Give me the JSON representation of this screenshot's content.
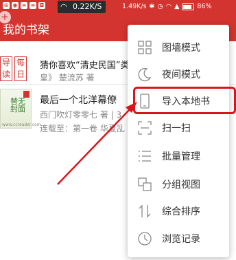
{
  "status_bar": {
    "speed": "0.22K/S",
    "net_rate": "1.49K/s",
    "battery": "86%"
  },
  "app_bar": {
    "title": "我的书架",
    "add_glyph": "+"
  },
  "books": [
    {
      "badge_left": "导读",
      "badge_right": "每日",
      "title": "猜你喜欢“清史民国”类",
      "subtitle": "皇》 楚流苏 著"
    },
    {
      "cover_text": "替无封面",
      "cover_caption": "www.ccreader.com",
      "title": "最后一个北洋幕僚",
      "author": "西门吹灯零零七 著 | 3",
      "progress": "连载至：第一卷 华夏乱"
    }
  ],
  "menu": {
    "items": [
      {
        "label": "图墙模式",
        "icon": "grid-icon"
      },
      {
        "label": "夜间模式",
        "icon": "moon-icon"
      },
      {
        "label": "导入本地书",
        "icon": "phone-icon"
      },
      {
        "label": "扫一扫",
        "icon": "scan-icon"
      },
      {
        "label": "批量管理",
        "icon": "list-icon"
      },
      {
        "label": "分组视图",
        "icon": "group-icon"
      },
      {
        "label": "综合排序",
        "icon": "sort-icon"
      },
      {
        "label": "浏览记录",
        "icon": "clock-icon"
      }
    ]
  },
  "annotation": {
    "highlight_color": "#d9141a"
  },
  "colors": {
    "brand": "#d4342f"
  }
}
